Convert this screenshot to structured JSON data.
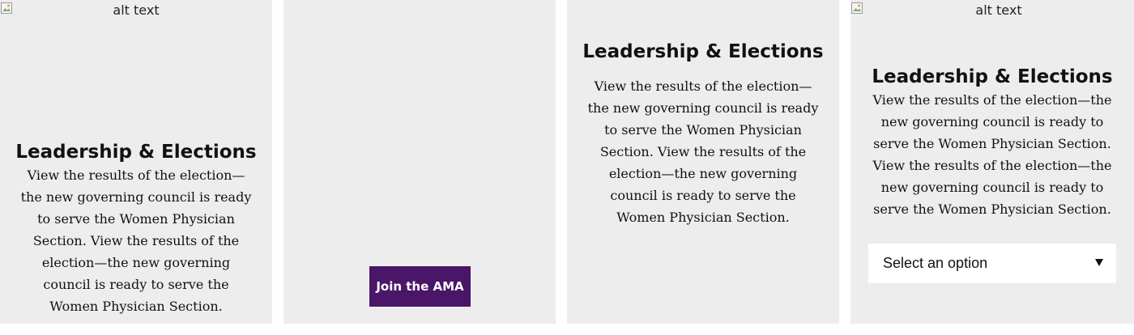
{
  "cards": [
    {
      "image_alt": "alt text",
      "heading": "Leadership & Elections",
      "description": "View the results of the election—the new governing council is ready to serve the Women Physician Section. View the results of the election—the new governing council is ready to serve the Women Physician Section."
    },
    {
      "button_label": "Join the AMA",
      "button_color": "#4a1667"
    },
    {
      "heading": "Leadership & Elections",
      "description": "View the results of the election—the new governing council is ready to serve the Women Physician Section. View the results of the election—the new governing council is ready to serve the Women Physician Section."
    },
    {
      "image_alt": "alt text",
      "heading": "Leadership & Elections",
      "description": "View the results of the election—the new governing council is ready to serve the Women Physician Section. View the results of the election—the new governing council is ready to serve the Women Physician Section.",
      "select": {
        "selected_label": "Select an option",
        "icon": "caret-down-icon"
      }
    }
  ],
  "colors": {
    "card_background": "#ededed",
    "page_background": "#ffffff",
    "button_background": "#4a1667",
    "button_text": "#ffffff"
  }
}
